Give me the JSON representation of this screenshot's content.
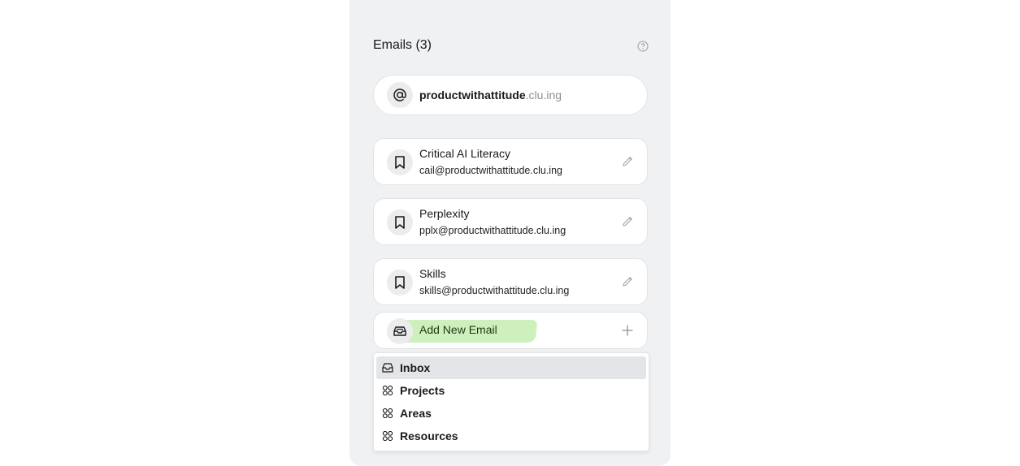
{
  "header": {
    "title": "Emails (3)",
    "help_icon": "help-circle-icon"
  },
  "domain": {
    "name": "productwithattitude",
    "suffix": ".clu.ing",
    "icon": "at-sign-icon"
  },
  "emails": [
    {
      "name": "Critical AI Literacy",
      "address": "cail@productwithattitude.clu.ing",
      "icon": "bookmark-icon",
      "action_icon": "pencil-icon"
    },
    {
      "name": "Perplexity",
      "address": "pplx@productwithattitude.clu.ing",
      "icon": "bookmark-icon",
      "action_icon": "pencil-icon"
    },
    {
      "name": "Skills",
      "address": "skills@productwithattitude.clu.ing",
      "icon": "bookmark-icon",
      "action_icon": "pencil-icon"
    }
  ],
  "add_email": {
    "label": "Add New Email",
    "icon": "inbox-stack-icon",
    "action_icon": "plus-icon",
    "highlight_color": "#c9eeb6"
  },
  "dropdown": {
    "items": [
      {
        "label": "Inbox",
        "icon": "inbox-icon",
        "selected": true
      },
      {
        "label": "Projects",
        "icon": "grid-circles-icon",
        "selected": false
      },
      {
        "label": "Areas",
        "icon": "grid-circles-icon",
        "selected": false
      },
      {
        "label": "Resources",
        "icon": "grid-circles-icon",
        "selected": false
      }
    ]
  },
  "colors": {
    "panel_bg": "#f0f1f3",
    "card_bg": "#ffffff",
    "selected_bg": "#e4e5e8",
    "muted_text": "#8d8f94"
  }
}
